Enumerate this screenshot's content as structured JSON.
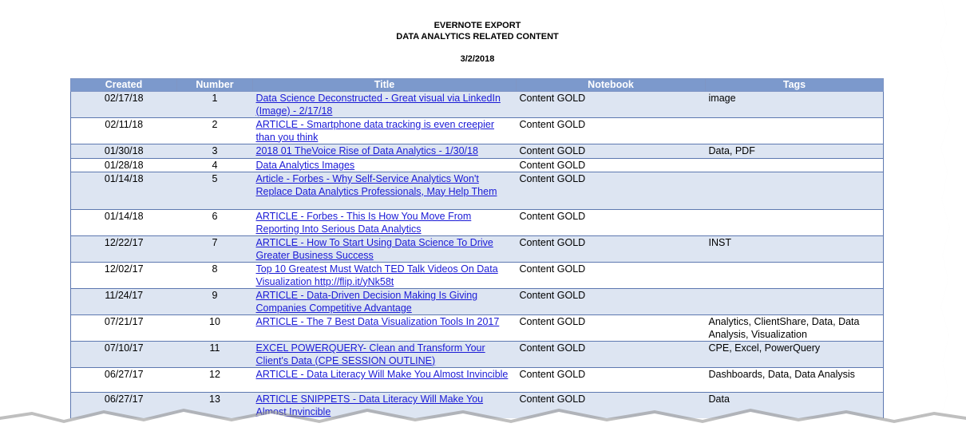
{
  "header": {
    "title": "EVERNOTE EXPORT",
    "subtitle": "DATA ANALYTICS RELATED CONTENT",
    "date": "3/2/2018"
  },
  "table": {
    "columns": [
      "Created",
      "Number",
      "Title",
      "Notebook",
      "Tags"
    ],
    "rows": [
      {
        "created": "02/17/18",
        "number": "1",
        "title": "Data Science Deconstructed - Great visual via LinkedIn (Image) - 2/17/18",
        "notebook": "Content GOLD",
        "tags": "image"
      },
      {
        "created": "02/11/18",
        "number": "2",
        "title": "ARTICLE - Smartphone data tracking is even creepier than you think",
        "notebook": "Content GOLD",
        "tags": ""
      },
      {
        "created": "01/30/18",
        "number": "3",
        "title": "2018 01  TheVoice  Rise of Data Analytics - 1/30/18",
        "notebook": "Content GOLD",
        "tags": "Data, PDF"
      },
      {
        "created": "01/28/18",
        "number": "4",
        "title": "Data Analytics Images",
        "notebook": "Content GOLD",
        "tags": ""
      },
      {
        "created": "01/14/18",
        "number": "5",
        "title": "Article - Forbes - Why Self-Service Analytics Won't Replace Data Analytics Professionals, May Help Them",
        "notebook": "Content GOLD",
        "tags": ""
      },
      {
        "created": "01/14/18",
        "number": "6",
        "title": "ARTICLE - Forbes - This Is How You Move From Reporting Into Serious Data Analytics",
        "notebook": "Content GOLD",
        "tags": ""
      },
      {
        "created": "12/22/17",
        "number": "7",
        "title": "ARTICLE - How To Start Using Data Science To Drive Greater Business Success",
        "notebook": "Content GOLD",
        "tags": "INST"
      },
      {
        "created": "12/02/17",
        "number": "8",
        "title": "Top 10 Greatest Must Watch TED Talk Videos On Data Visualization http://flip.it/yNk58t",
        "notebook": "Content GOLD",
        "tags": ""
      },
      {
        "created": "11/24/17",
        "number": "9",
        "title": "ARTICLE - Data-Driven Decision Making Is Giving Companies Competitive Advantage",
        "notebook": "Content GOLD",
        "tags": ""
      },
      {
        "created": "07/21/17",
        "number": "10",
        "title": "ARTICLE - The 7 Best Data Visualization Tools In 2017",
        "notebook": "Content GOLD",
        "tags": "Analytics, ClientShare, Data, Data Analysis, Visualization"
      },
      {
        "created": "07/10/17",
        "number": "11",
        "title": "EXCEL POWERQUERY- Clean and Transform Your Client's Data (CPE SESSION OUTLINE)",
        "notebook": "Content GOLD",
        "tags": "CPE, Excel, PowerQuery"
      },
      {
        "created": "06/27/17",
        "number": "12",
        "title": "ARTICLE - Data Literacy Will Make You Almost Invincible",
        "notebook": "Content GOLD",
        "tags": "Dashboards, Data, Data Analysis"
      },
      {
        "created": "06/27/17",
        "number": "13",
        "title": "ARTICLE SNIPPETS - Data Literacy Will Make You Almost Invincible",
        "notebook": "Content GOLD",
        "tags": "Data"
      }
    ]
  }
}
